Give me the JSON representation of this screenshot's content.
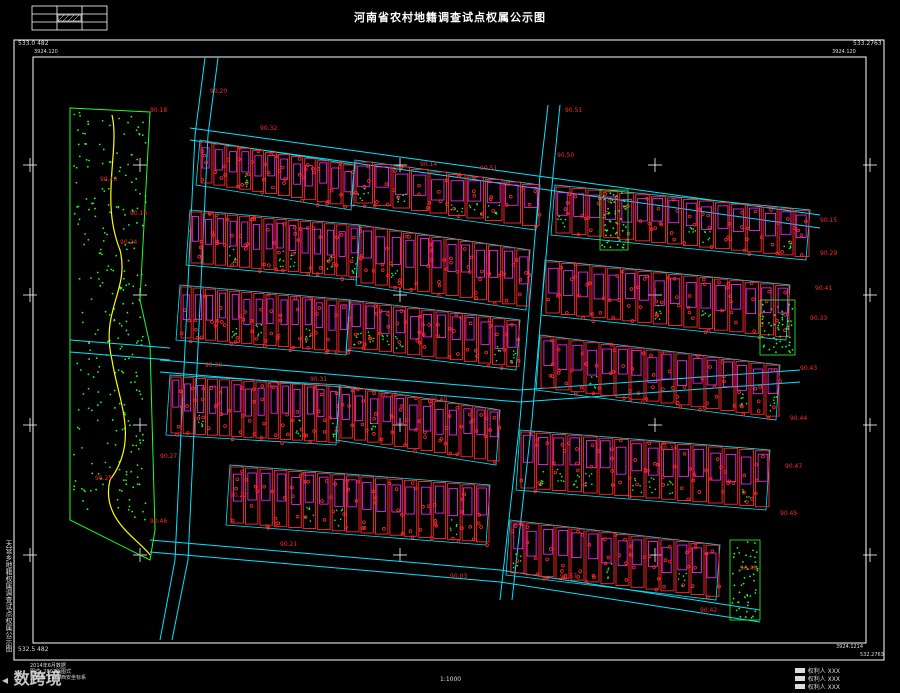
{
  "title": "河南省农村地籍调查试点权属公示图",
  "corner_labels": {
    "top_left": "533.0 482",
    "top_left_sub": "3924.120",
    "top_right": "533.2763",
    "top_right_sub": "3924.120",
    "bottom_left": "532.5 482",
    "bottom_right": "3924.1214",
    "bottom_right_sub": "532.2763"
  },
  "scale": "1:1000",
  "side_text": "天营乡地籍权属调查试点权属公示图",
  "stamp_lines": [
    "2014年6月数据",
    "图式: 2007版图式",
    "坐标系: 1980西安坐标系"
  ],
  "watermark": "数跨境",
  "legend": [
    "权利人 XXX",
    "权利人 XXX",
    "权利人 XXX"
  ],
  "parcel_labels": [
    "90.20",
    "90.18",
    "90.10",
    "90.51",
    "90.50",
    "90.30",
    "90.31",
    "90.40",
    "90.23",
    "90.24",
    "90.16",
    "90.15",
    "90.29",
    "90.41",
    "90.33",
    "90.43",
    "90.44",
    "90.47",
    "90.45",
    "90.48",
    "90.42",
    "90.57",
    "90.03",
    "90.21",
    "90.46",
    "90.25",
    "90.27",
    "90.22",
    "90.14",
    "90.32",
    "90.51",
    "90.34"
  ],
  "colors": {
    "road": "#00e5ff",
    "parcel": "#ff2a2a",
    "building": "#ff2aff",
    "green": "#22ff22",
    "yellow": "#ffff00",
    "frame": "#ffffff"
  }
}
